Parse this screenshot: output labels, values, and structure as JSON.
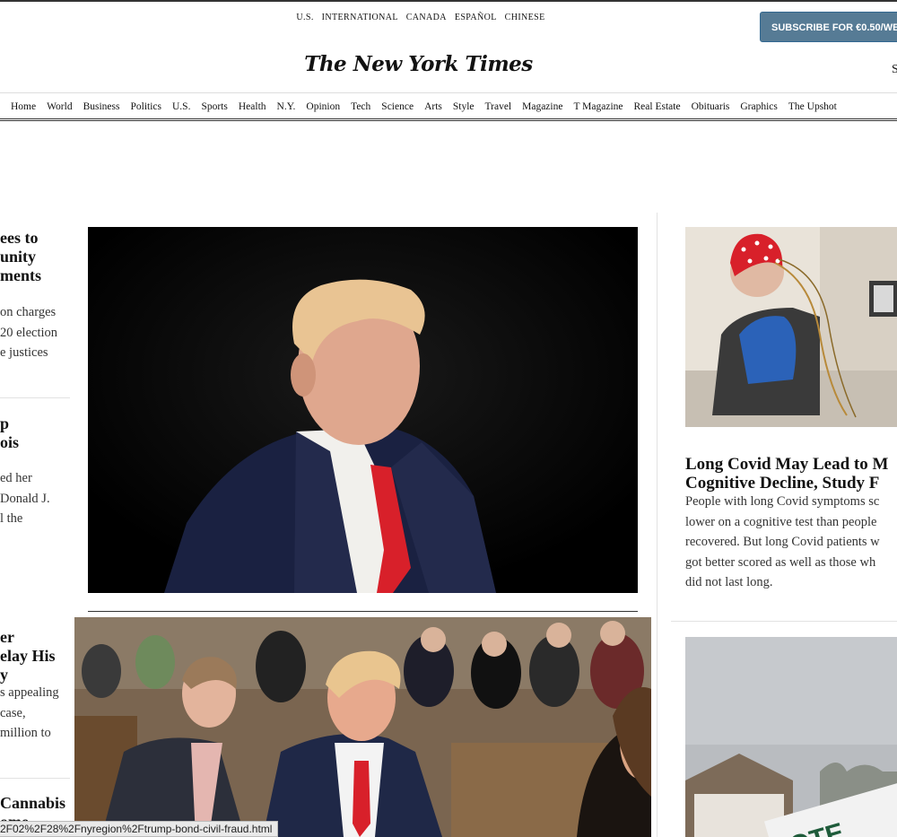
{
  "header": {
    "editions": [
      "U.S.",
      "INTERNATIONAL",
      "CANADA",
      "ESPAÑOL",
      "CHINESE"
    ],
    "subscribe_label": "SUBSCRIBE FOR €0.50/WE",
    "masthead": "The New York Times",
    "edge_mark": "S"
  },
  "nav": {
    "items": [
      "Home",
      "World",
      "Business",
      "Politics",
      "U.S.",
      "Sports",
      "Health",
      "N.Y.",
      "Opinion",
      "Tech",
      "Science",
      "Arts",
      "Style",
      "Travel",
      "Magazine",
      "T Magazine",
      "Real Estate",
      "Obituaris",
      "Graphics",
      "The Upshot"
    ]
  },
  "stories": {
    "lead": {
      "headline": [
        "ees to",
        "unity",
        "ments"
      ],
      "summary": [
        "on charges",
        "20 election",
        "e justices"
      ]
    },
    "second": {
      "headline": [
        "p",
        "ois"
      ],
      "summary": [
        "ed her",
        "Donald J.",
        "l the"
      ]
    },
    "third": {
      "headline": [
        "er",
        "elay His",
        "y"
      ],
      "summary": [
        "s appealing",
        "case,",
        "million to"
      ]
    },
    "fourth": {
      "headline": [
        "Cannabis",
        "ome"
      ]
    },
    "covid": {
      "headline": [
        "Long Covid May Lead to M",
        "Cognitive Decline, Study F"
      ],
      "summary": [
        "People with long Covid symptoms sc",
        "lower on a cognitive test than people",
        "recovered. But long Covid patients w",
        "got better scored as well as those wh",
        "did not last long."
      ]
    }
  },
  "images": {
    "vote_sign_text": "OTE"
  },
  "status_bar": "2F02%2F28%2Fnyregion%2Ftrump-bond-civil-fraud.html",
  "colors": {
    "subscribe_bg": "#567b95",
    "tie_red": "#d8202a",
    "eeg_cap": "#d8202a"
  }
}
